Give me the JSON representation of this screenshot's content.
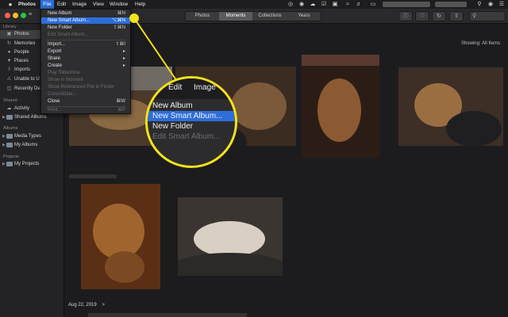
{
  "menubar": {
    "apple": "",
    "app": "Photos",
    "items": [
      "File",
      "Edit",
      "Image",
      "View",
      "Window",
      "Help"
    ]
  },
  "toolbar": {
    "view_tabs": [
      "Photos",
      "Moments",
      "Collections",
      "Years"
    ],
    "active_tab": "Moments"
  },
  "sidebar": {
    "library_header": "Library",
    "library_items": [
      "Photos",
      "Memories",
      "People",
      "Places",
      "Imports",
      "Unable to U",
      "Recently De"
    ],
    "shared_header": "Shared",
    "shared_items": [
      "Activity",
      "Shared Albums"
    ],
    "albums_header": "Albums",
    "album_items": [
      "Media Types",
      "My Albums"
    ],
    "projects_header": "Projects",
    "project_items": [
      "My Projects"
    ]
  },
  "main": {
    "showing_label": "Showing:",
    "showing_value": "All Items",
    "section_date": "Aug 22, 2019",
    "section_chevron": ">"
  },
  "file_menu": {
    "items": [
      {
        "label": "New Album",
        "shortcut": "⌘N",
        "enabled": true
      },
      {
        "label": "New Smart Album...",
        "shortcut": "⌥⌘N",
        "enabled": true,
        "highlighted": true
      },
      {
        "label": "New Folder",
        "shortcut": "⇧⌘N",
        "enabled": true
      },
      {
        "label": "Edit Smart Album...",
        "shortcut": "",
        "enabled": false
      },
      {
        "label": "Import...",
        "shortcut": "⇧⌘I",
        "enabled": true
      },
      {
        "label": "Export",
        "shortcut": "▸",
        "enabled": true
      },
      {
        "label": "Share",
        "shortcut": "▸",
        "enabled": true
      },
      {
        "label": "Create",
        "shortcut": "▸",
        "enabled": true
      },
      {
        "label": "Play Slideshow",
        "shortcut": "",
        "enabled": false
      },
      {
        "label": "Show in Moment",
        "shortcut": "",
        "enabled": false
      },
      {
        "label": "Show Referenced File in Finder",
        "shortcut": "",
        "enabled": false
      },
      {
        "label": "Consolidate...",
        "shortcut": "",
        "enabled": false
      },
      {
        "label": "Close",
        "shortcut": "⌘W",
        "enabled": true
      },
      {
        "label": "Print...",
        "shortcut": "⌘P",
        "enabled": false
      }
    ]
  },
  "magnifier": {
    "menu_items": [
      "Edit",
      "Image"
    ],
    "items": [
      "New Album",
      "New Smart Album...",
      "New Folder",
      "Edit Smart Album..."
    ]
  },
  "colors": {
    "accent": "#2d6ed8",
    "highlight_ring": "#f4e21a"
  }
}
